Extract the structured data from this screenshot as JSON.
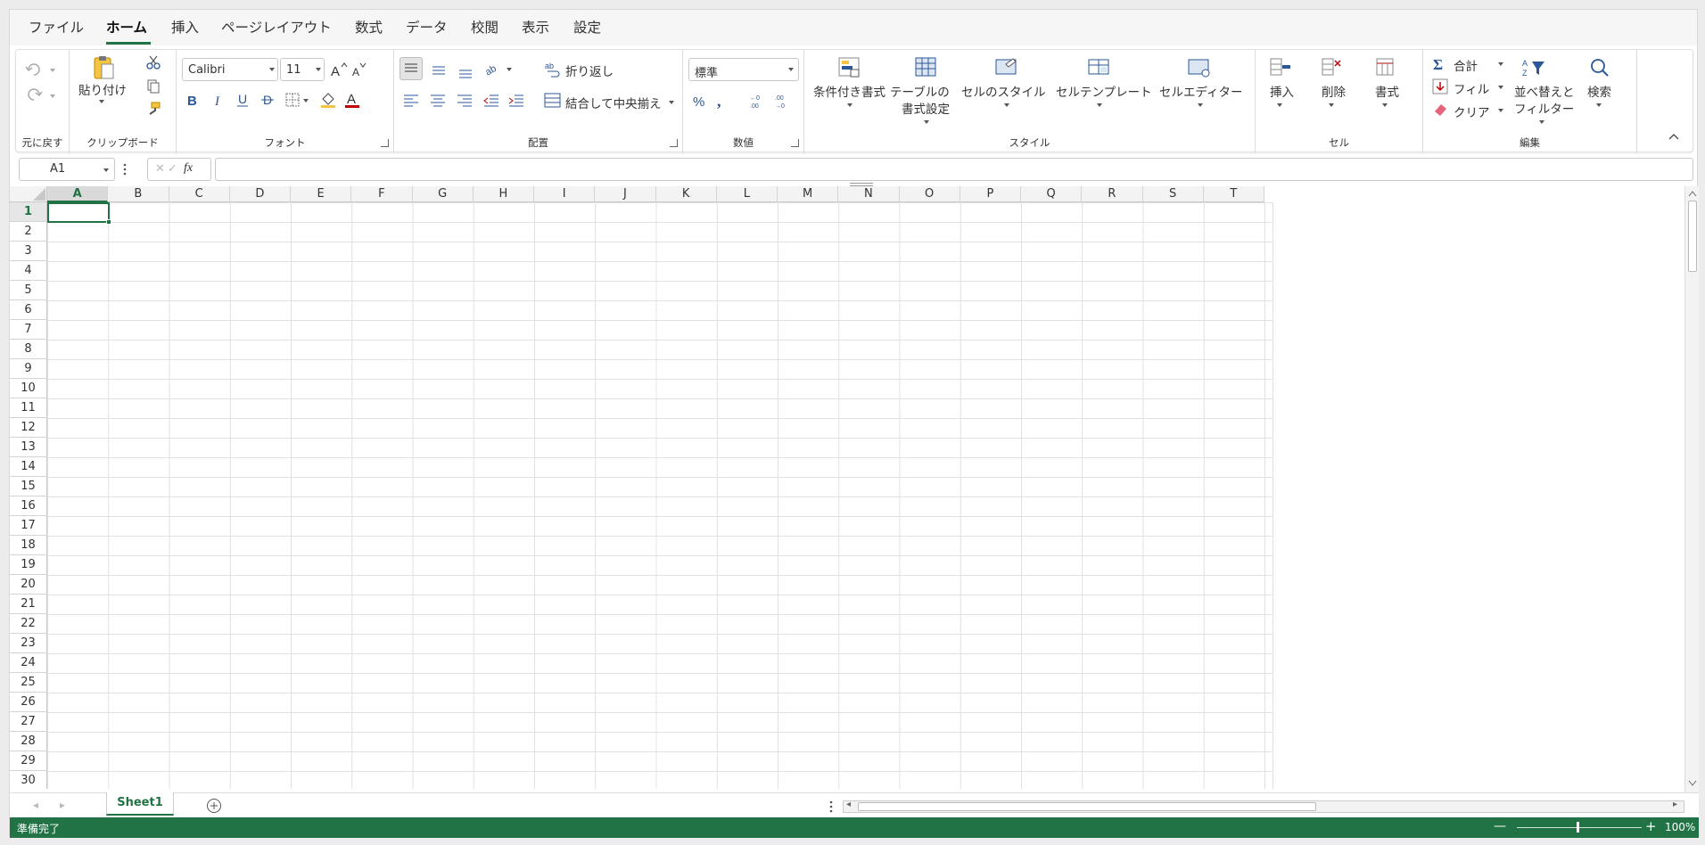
{
  "menu": {
    "file": "ファイル",
    "home": "ホーム",
    "insert": "挿入",
    "page_layout": "ページレイアウト",
    "formulas": "数式",
    "data": "データ",
    "review": "校閲",
    "view": "表示",
    "settings": "設定"
  },
  "ribbon": {
    "undo_group": "元に戻す",
    "clipboard": {
      "paste": "貼り付け",
      "label": "クリップボード"
    },
    "font": {
      "name": "Calibri",
      "size": "11",
      "label": "フォント"
    },
    "alignment": {
      "wrap": "折り返し",
      "merge": "結合して中央揃え",
      "label": "配置"
    },
    "number": {
      "format": "標準",
      "label": "数値"
    },
    "styles": {
      "conditional": "条件付き書式",
      "table_line1": "テーブルの",
      "table_line2": "書式設定",
      "cell_styles": "セルのスタイル",
      "cell_template": "セルテンプレート",
      "cell_editor": "セルエディター",
      "label": "スタイル"
    },
    "cells": {
      "insert": "挿入",
      "delete": "削除",
      "format": "書式",
      "label": "セル"
    },
    "editing": {
      "sum": "合計",
      "fill": "フィル",
      "clear": "クリア",
      "sort_line1": "並べ替えと",
      "sort_line2": "フィルター",
      "find": "検索",
      "label": "編集"
    }
  },
  "formula_bar": {
    "name_box": "A1",
    "fx": "fx",
    "value": ""
  },
  "columns": [
    "A",
    "B",
    "C",
    "D",
    "E",
    "F",
    "G",
    "H",
    "I",
    "J",
    "K",
    "L",
    "M",
    "N",
    "O",
    "P",
    "Q",
    "R",
    "S",
    "T"
  ],
  "rows": [
    "1",
    "2",
    "3",
    "4",
    "5",
    "6",
    "7",
    "8",
    "9",
    "10",
    "11",
    "12",
    "13",
    "14",
    "15",
    "16",
    "17",
    "18",
    "19",
    "20",
    "21",
    "22",
    "23",
    "24",
    "25",
    "26",
    "27",
    "28",
    "29",
    "30"
  ],
  "selected_cell": "A1",
  "sheet_tab": "Sheet1",
  "status": {
    "ready": "準備完了",
    "zoom": "100%"
  },
  "colors": {
    "accent": "#217346",
    "status_bar": "#217346"
  }
}
